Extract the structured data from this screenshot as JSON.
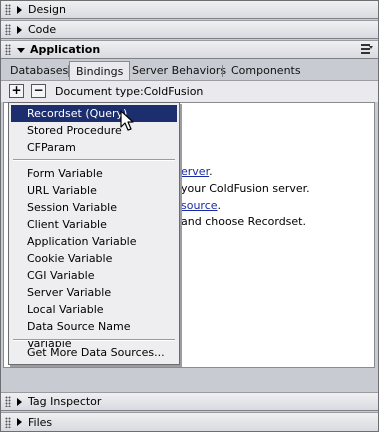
{
  "panels": {
    "design": "Design",
    "code": "Code",
    "application": "Application",
    "tag_inspector": "Tag Inspector",
    "files": "Files"
  },
  "tabs": [
    "Databases",
    "Bindings",
    "Server Behaviors",
    "Components"
  ],
  "toolbar": {
    "add_label": "+",
    "remove_label": "−",
    "doc_type": "Document type:ColdFusion"
  },
  "content_lines": {
    "line1_link": "erver",
    "line1_tail": ".",
    "line2": "your ColdFusion server.",
    "line3_link": "source",
    "line3_tail": ".",
    "line4": "and choose Recordset."
  },
  "menu": {
    "group1": [
      "Recordset (Query)",
      "Stored Procedure",
      "CFParam"
    ],
    "group2": [
      "Form Variable",
      "URL Variable",
      "Session Variable",
      "Client Variable",
      "Application Variable",
      "Cookie Variable",
      "CGI Variable",
      "Server Variable",
      "Local Variable",
      "Data Source Name Variable"
    ],
    "group3": [
      "Get More Data Sources..."
    ],
    "selected": "Recordset (Query)"
  },
  "colors": {
    "selection": "#1c2e6e",
    "link": "#1a2aa6",
    "panel_bg": "#c9cbd3"
  }
}
